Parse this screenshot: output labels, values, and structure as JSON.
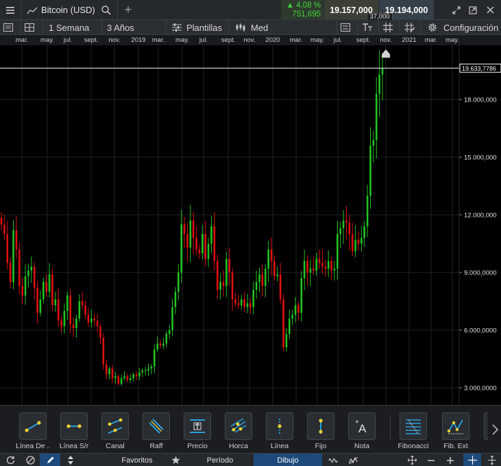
{
  "topbar": {
    "instrument": "Bitcoin (USD)",
    "change_pct": "4,08 %",
    "change_abs": "751,695",
    "bid": "19.157,000",
    "ask": "19.194,000",
    "spread": "37,000"
  },
  "toolbar": {
    "period": "1 Semana",
    "range": "3 Años",
    "templates": "Plantillas",
    "price_type": "Med",
    "settings": "Configuración"
  },
  "x_axis": [
    "mar.",
    "may.",
    "jul.",
    "sept.",
    "nov.",
    "2019",
    "mar.",
    "may.",
    "jul.",
    "sept.",
    "nov.",
    "2020",
    "mar.",
    "may.",
    "jul.",
    "sept.",
    "nov.",
    "2021",
    "mar.",
    "may."
  ],
  "price_axis": {
    "current": "19.633,7786",
    "labels": [
      "18.000,000",
      "15.000,000",
      "12.000,000",
      "9.000,0000",
      "6.000,0000",
      "3.000,0000"
    ]
  },
  "chart_data": {
    "type": "candlestick",
    "title": "",
    "xlabel": "",
    "ylabel": "",
    "ylim": [
      1700,
      21400
    ],
    "current_price": 19633.7786,
    "up_color": "#22c322",
    "down_color": "#e01010",
    "closes": [
      11500,
      11000,
      9500,
      8500,
      11200,
      10200,
      8300,
      7800,
      8800,
      9100,
      9300,
      8200,
      6900,
      7600,
      8500,
      8000,
      8900,
      7300,
      7600,
      6500,
      6200,
      7000,
      7800,
      6300,
      6100,
      6600,
      7500,
      7300,
      6800,
      6400,
      6600,
      6500,
      6200,
      5600,
      4200,
      3700,
      4000,
      3500,
      3600,
      3200,
      3500,
      3600,
      3400,
      3500,
      3700,
      3600,
      3800,
      3900,
      3900,
      4000,
      4100,
      5000,
      5300,
      5200,
      5300,
      5800,
      6000,
      7200,
      8000,
      9000,
      11500,
      11000,
      10300,
      11700,
      10800,
      10200,
      10000,
      11000,
      9700,
      10500,
      11400,
      9600,
      8100,
      8500,
      8300,
      9700,
      9000,
      7600,
      7400,
      7300,
      7600,
      7200,
      7400,
      7200,
      8100,
      8500,
      8900,
      8300,
      9200,
      10200,
      9600,
      8800,
      8900,
      7600,
      5100,
      5800,
      6600,
      6800,
      7300,
      6900,
      8700,
      9600,
      9000,
      9200,
      9100,
      9700,
      9500,
      9300,
      9200,
      9600,
      9100,
      9200,
      11000,
      11300,
      11700,
      11600,
      11000,
      10100,
      10700,
      10500,
      10800,
      11400,
      13000,
      15600,
      15900,
      18300,
      19300,
      19634
    ]
  },
  "tools": [
    {
      "label": "Línea De ...",
      "icon": "trend-line-icon"
    },
    {
      "label": "Línea S/r",
      "icon": "sr-line-icon"
    },
    {
      "label": "Canal",
      "icon": "channel-icon"
    },
    {
      "label": "Raff",
      "icon": "raff-icon"
    },
    {
      "label": "Precio",
      "icon": "price-icon"
    },
    {
      "label": "Horca",
      "icon": "pitchfork-icon"
    },
    {
      "label": "Línea",
      "icon": "vertical-line-icon"
    },
    {
      "label": "Fijo",
      "icon": "fixed-icon"
    },
    {
      "label": "Nota",
      "icon": "note-icon"
    },
    {
      "label": "Fibonacci",
      "icon": "fibonacci-icon"
    },
    {
      "label": "Fib. Ext",
      "icon": "fib-ext-icon"
    }
  ],
  "bottombar": {
    "favorites": "Favoritos",
    "period_tab": "Período",
    "drawing_tab": "Dibujo"
  },
  "colors": {
    "up": "#22c322",
    "down": "#e01010",
    "accent_tab": "#1d4a7a",
    "tool_line": "#2aa0e0",
    "tool_handle": "#f0d030"
  }
}
